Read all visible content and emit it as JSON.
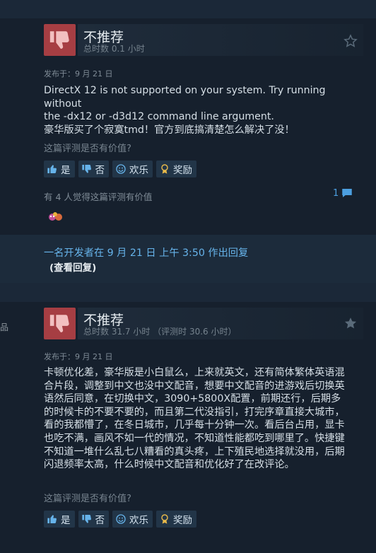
{
  "reviews": [
    {
      "verdict": "不推荐",
      "hours": "总时数 0.1 小时",
      "posted": "发布于：9 月 21 日",
      "body_lines": [
        "DirectX 12 is not supported on your system. Try running without",
        "the -dx12 or -d3d12 command line argument.",
        "豪华版买了个寂寞tmd！官方到底搞清楚怎么解决了没！"
      ],
      "helpful_question": "这篇评测是否有价值?",
      "buttons": {
        "yes": "是",
        "no": "否",
        "funny": "欢乐",
        "award": "奖励"
      },
      "found_helpful": "有 4 人觉得这篇评测有价值",
      "comment_count": "1"
    },
    {
      "verdict": "不推荐",
      "hours": "总时数 31.7 小时 （评测时 30.6 小时）",
      "posted": "发布于：9 月 21 日",
      "body_lines": [
        "卡顿优化差，豪华版是小白鼠么，上来就英文，还有简体繁体英语混",
        "合片段，调整到中文也没中文配音，想要中文配音的进游戏后切换英",
        "语然后同意，在切换中文，3090+5800X配置，前期还行，后期多",
        "的时候卡的不要不要的，而且第二代没指引，打完序章直接大城市，",
        "看的我都懵了，在冬日城市，几乎每十分钟一次。看后台占用，显卡",
        "也吃不满，画风不如一代的情况，不知道性能都吃到哪里了。快捷键",
        "不知道一堆什么乱七八糟看的真头疼，上下殖民地选择就没用，后期",
        "闪退频率太高，什么时候中文配音和优化好了在改评论。"
      ],
      "helpful_question": "这篇评测是否有价值?",
      "buttons": {
        "yes": "是",
        "no": "否",
        "funny": "欢乐",
        "award": "奖励"
      }
    }
  ],
  "developer_response": {
    "line": "一名开发者在 9 月 21 日 上午 3:50 作出回复",
    "link": "(查看回复)"
  },
  "left_edge_text": "品",
  "colors": {
    "thumb_bg": "#a63e43",
    "link_blue": "#66b3ea",
    "card_bg": "#16202d"
  },
  "icons": [
    "thumbs-down-icon",
    "star-icon",
    "thumbs-up-icon",
    "smiley-icon",
    "award-icon",
    "comment-icon"
  ]
}
